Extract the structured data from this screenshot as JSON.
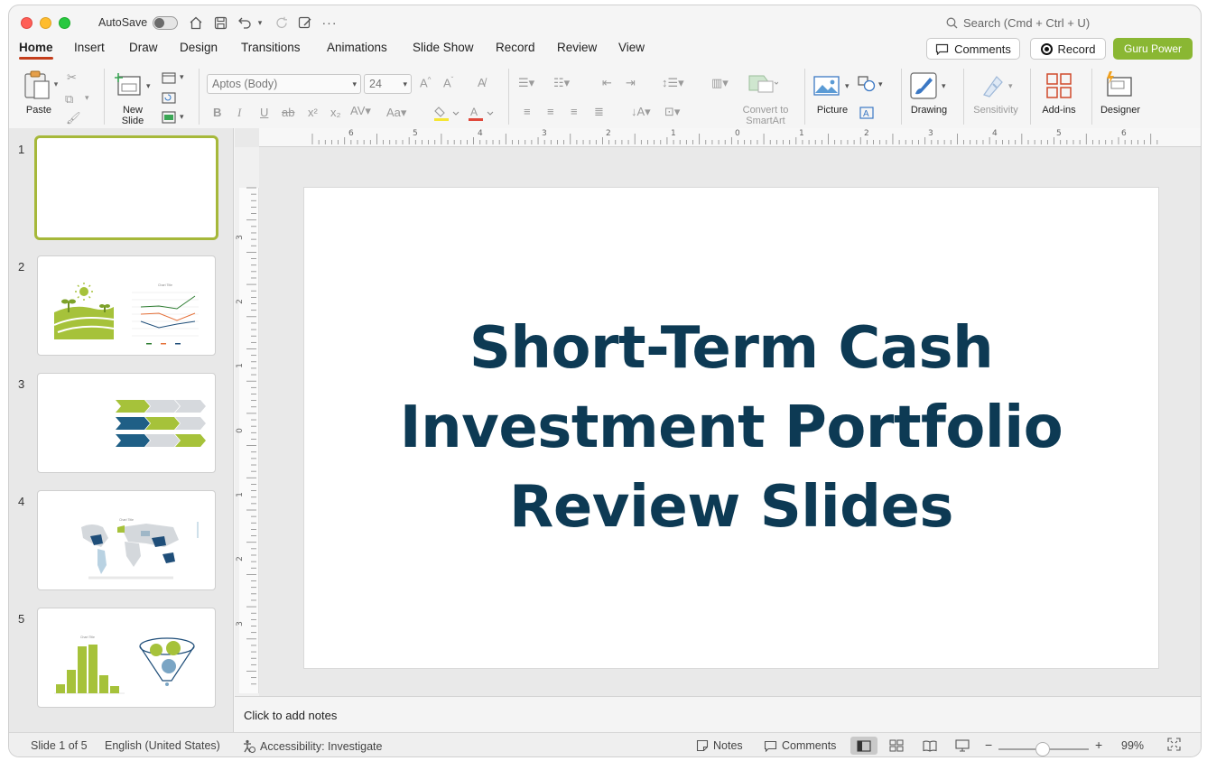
{
  "titlebar": {
    "autosave_label": "AutoSave",
    "search_placeholder": "Search (Cmd + Ctrl + U)"
  },
  "tabs": [
    {
      "label": "Home",
      "active": true
    },
    {
      "label": "Insert"
    },
    {
      "label": "Draw"
    },
    {
      "label": "Design"
    },
    {
      "label": "Transitions"
    },
    {
      "label": "Animations"
    },
    {
      "label": "Slide Show"
    },
    {
      "label": "Record"
    },
    {
      "label": "Review"
    },
    {
      "label": "View"
    }
  ],
  "actions": {
    "comments_label": "Comments",
    "record_label": "Record",
    "guru_label": "Guru Power"
  },
  "ribbon": {
    "paste_label": "Paste",
    "new_slide_line1": "New",
    "new_slide_line2": "Slide",
    "font_name": "Aptos (Body)",
    "font_size": "24",
    "convert_line1": "Convert to",
    "convert_line2": "SmartArt",
    "picture_label": "Picture",
    "drawing_label": "Drawing",
    "sensitivity_label": "Sensitivity",
    "addins_label": "Add-ins",
    "designer_label": "Designer"
  },
  "slides": [
    {
      "number": "1"
    },
    {
      "number": "2"
    },
    {
      "number": "3"
    },
    {
      "number": "4"
    },
    {
      "number": "5"
    }
  ],
  "ruler": {
    "h_ticks": [
      "6",
      "5",
      "4",
      "3",
      "2",
      "1",
      "0",
      "1",
      "2",
      "3",
      "4",
      "5",
      "6"
    ],
    "v_ticks": [
      "3",
      "2",
      "1",
      "0",
      "1",
      "2",
      "3"
    ]
  },
  "slide": {
    "title_line1": "Short-Term Cash",
    "title_line2": "Investment Portfolio",
    "title_line3": "Review Slides"
  },
  "notes": {
    "placeholder": "Click to add notes"
  },
  "status": {
    "slide_info": "Slide 1 of 5",
    "language": "English (United States)",
    "accessibility": "Accessibility: Investigate",
    "notes_label": "Notes",
    "comments_label": "Comments",
    "zoom": "99%",
    "zoom_level_fraction": 0.5
  },
  "colors": {
    "accent_green": "#8ab733",
    "title_navy": "#0d3a54",
    "tab_underline": "#c43e1c"
  }
}
